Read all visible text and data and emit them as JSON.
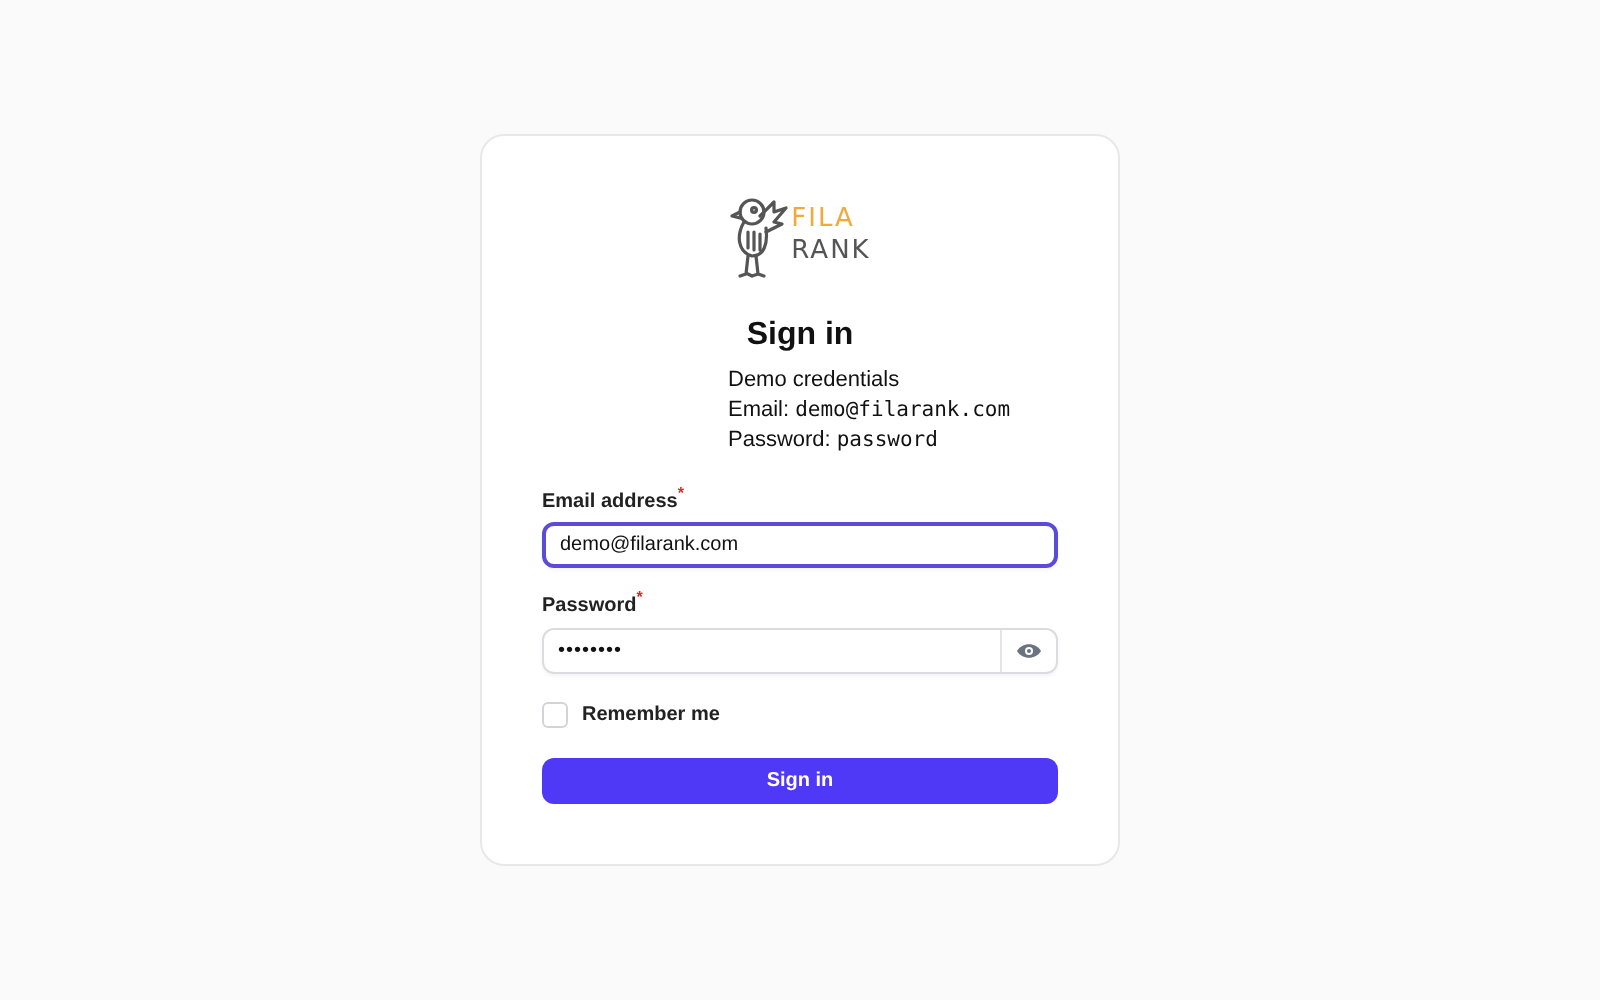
{
  "logo": {
    "line_1": "FILA",
    "line_2": "RANK"
  },
  "title": "Sign in",
  "credential_lines": [
    {
      "label": "Demo credentials"
    },
    {
      "label": "Email:",
      "code": "demo@filarank.com"
    },
    {
      "label": "Password:",
      "code": "password"
    }
  ],
  "fields": [
    {
      "label": "Email address",
      "required_mark": "*",
      "value": "demo@filarank.com",
      "focused": true,
      "kind": "text"
    },
    {
      "label": "Password",
      "required_mark": "*",
      "value": "••••••••",
      "focused": false,
      "kind": "password"
    }
  ],
  "remember": {
    "label": "Remember me",
    "checked": false
  },
  "submit": "Sign in"
}
